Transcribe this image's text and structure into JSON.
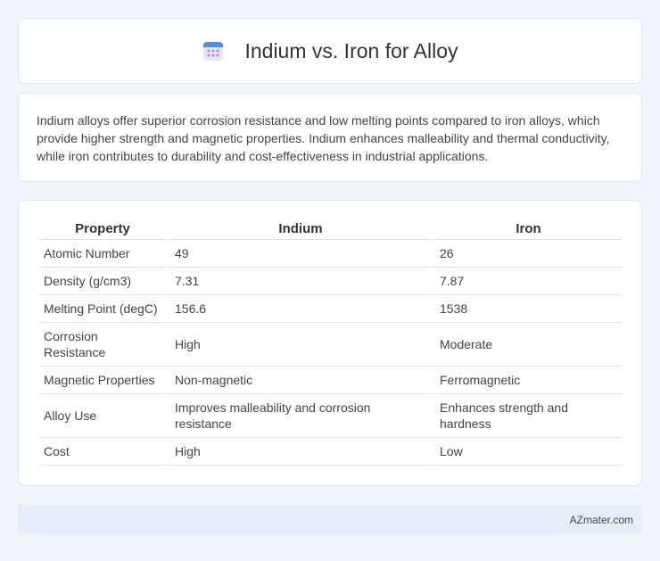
{
  "header": {
    "title": "Indium vs. Iron for Alloy",
    "icon": "calendar-icon"
  },
  "summary": "Indium alloys offer superior corrosion resistance and low melting points compared to iron alloys, which provide higher strength and magnetic properties. Indium enhances malleability and thermal conductivity, while iron contributes to durability and cost-effectiveness in industrial applications.",
  "table": {
    "headers": [
      "Property",
      "Indium",
      "Iron"
    ],
    "rows": [
      [
        "Atomic Number",
        "49",
        "26"
      ],
      [
        "Density (g/cm3)",
        "7.31",
        "7.87"
      ],
      [
        "Melting Point (degC)",
        "156.6",
        "1538"
      ],
      [
        "Corrosion Resistance",
        "High",
        "Moderate"
      ],
      [
        "Magnetic Properties",
        "Non-magnetic",
        "Ferromagnetic"
      ],
      [
        "Alloy Use",
        "Improves malleability and corrosion resistance",
        "Enhances strength and hardness"
      ],
      [
        "Cost",
        "High",
        "Low"
      ]
    ]
  },
  "footer": {
    "brand": "AZmater.com"
  },
  "colors": {
    "background": "#f1f4f9",
    "card": "#ffffff",
    "footer": "#e6edf8"
  }
}
